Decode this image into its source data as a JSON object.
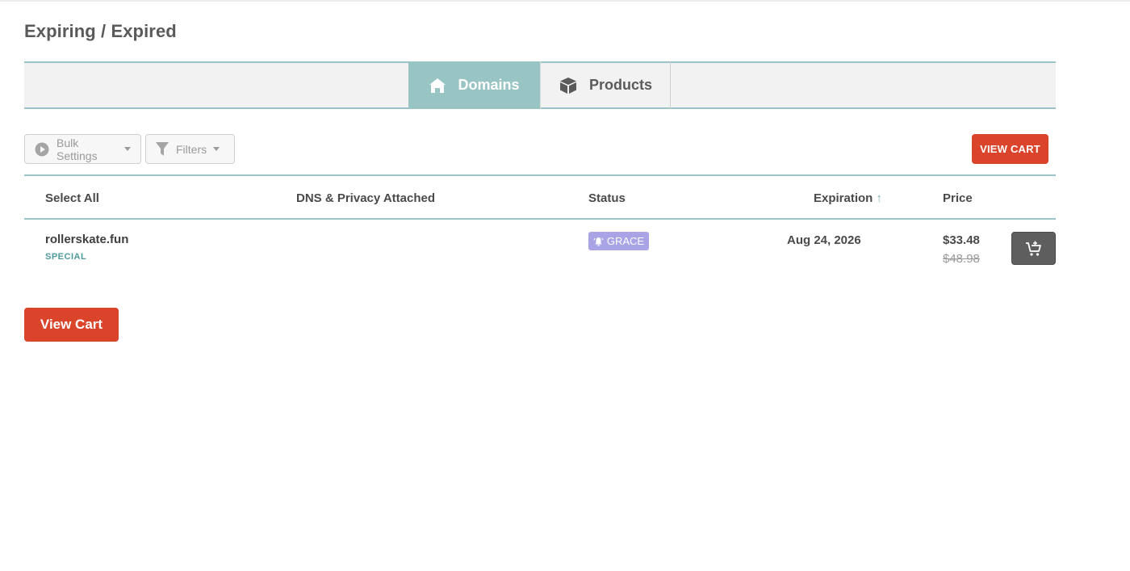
{
  "page": {
    "title": "Expiring / Expired"
  },
  "tabs": [
    {
      "label": "Domains",
      "icon": "house-icon",
      "active": true
    },
    {
      "label": "Products",
      "icon": "box-icon",
      "active": false
    }
  ],
  "toolbar": {
    "bulk_settings_label": "Bulk Settings",
    "filters_label": "Filters",
    "view_cart_label": "VIEW CART"
  },
  "table": {
    "columns": {
      "select_all": "Select All",
      "dns_privacy": "DNS & Privacy Attached",
      "status": "Status",
      "expiration": "Expiration",
      "expiration_sort": "↑",
      "price": "Price"
    },
    "rows": [
      {
        "domain": "rollerskate.fun",
        "tag": "SPECIAL",
        "status": "GRACE",
        "expiration": "Aug 24, 2026",
        "price": "$33.48",
        "original_price": "$48.98"
      }
    ]
  },
  "footer": {
    "view_cart_label": "View Cart"
  },
  "colors": {
    "accent_teal": "#99c4c4",
    "cta_red": "#d9442b",
    "grace_badge": "#a9a4e6",
    "special_tag": "#4f9b9e"
  }
}
